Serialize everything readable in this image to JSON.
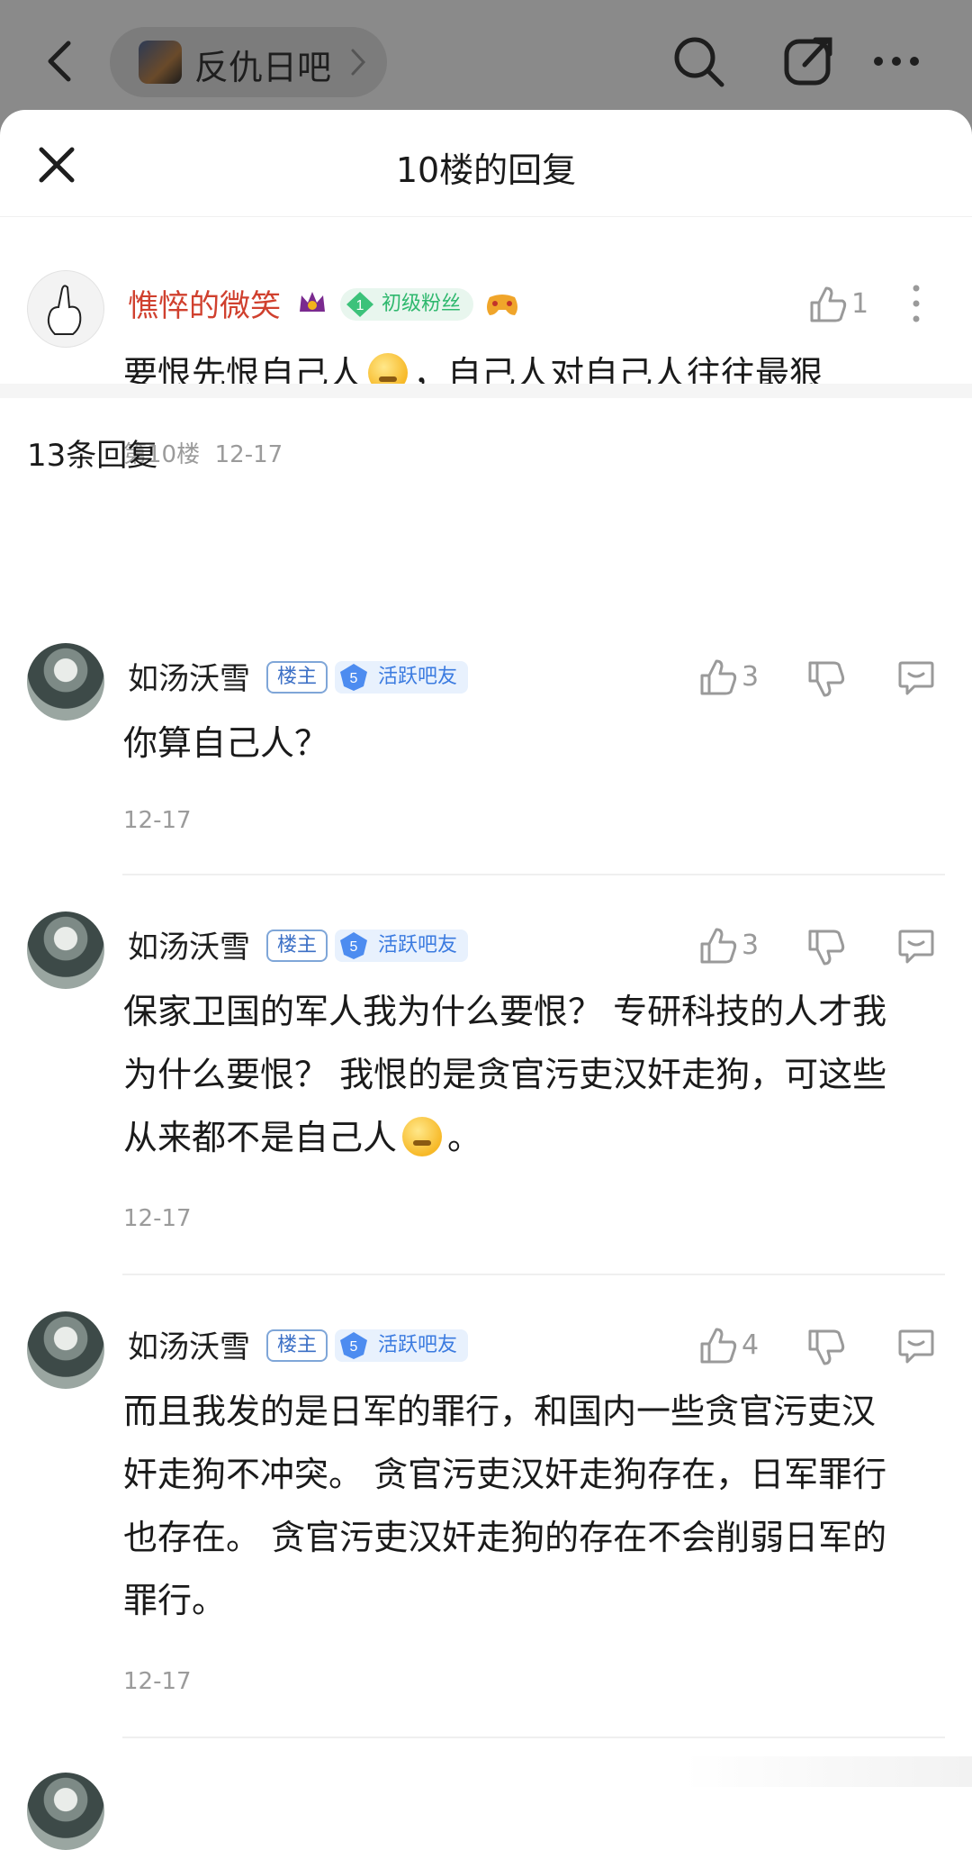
{
  "topbar": {
    "forum_name": "反仇日吧"
  },
  "sheet": {
    "title": "10楼的回复"
  },
  "main_post": {
    "username": "憔悴的微笑",
    "fan_badge_level": "1",
    "fan_badge_label": "初级粉丝",
    "like_count": "1",
    "text_before_emoji": "要恨先恨自己人",
    "text_after_emoji": "，自己人对自己人往往最狠",
    "floor": "第10楼",
    "date": "12-17"
  },
  "replies_header": {
    "count_label": "13条回复"
  },
  "replies": [
    {
      "username": "如汤沃雪",
      "owner_tag": "楼主",
      "level": "5",
      "level_label": "活跃吧友",
      "like_count": "3",
      "lines": [
        "你算自己人？"
      ],
      "date": "12-17"
    },
    {
      "username": "如汤沃雪",
      "owner_tag": "楼主",
      "level": "5",
      "level_label": "活跃吧友",
      "like_count": "3",
      "lines": [
        "保家卫国的军人我为什么要恨？ 专研科技的人才我",
        "为什么要恨？ 我恨的是贪官污吏汉奸走狗，可这些",
        "从来都不是自己人"
      ],
      "last_line_suffix": "。",
      "date": "12-17"
    },
    {
      "username": "如汤沃雪",
      "owner_tag": "楼主",
      "level": "5",
      "level_label": "活跃吧友",
      "like_count": "4",
      "lines": [
        "而且我发的是日军的罪行，和国内一些贪官污吏汉",
        "奸走狗不冲突。 贪官污吏汉奸走狗存在，日军罪行",
        "也存在。 贪官污吏汉奸走狗的存在不会削弱日军的",
        "罪行。"
      ],
      "date": "12-17"
    }
  ],
  "colors": {
    "username_red": "#d0402e",
    "fan_green": "#2fb86e",
    "tag_blue": "#3b7be0",
    "meta_gray": "#9b9b9b"
  },
  "icons": [
    "back-icon",
    "chevron-right-icon",
    "search-icon",
    "share-icon",
    "more-icon",
    "close-icon",
    "thumb-up-icon",
    "thumb-down-icon",
    "reply-bubble-icon",
    "crown-icon",
    "gem-icon",
    "gamepad-icon"
  ]
}
